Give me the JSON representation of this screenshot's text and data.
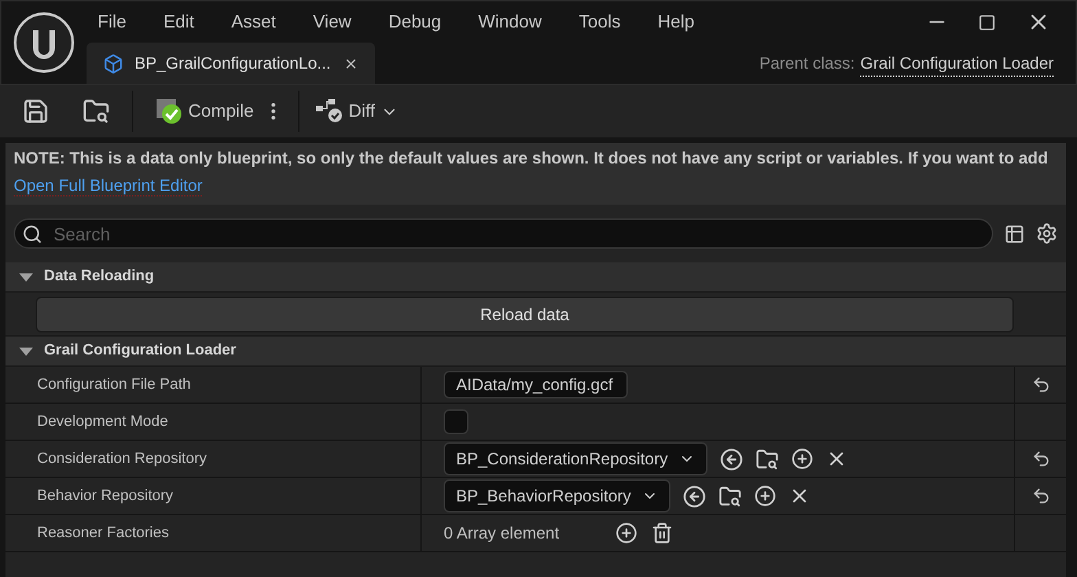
{
  "menu": [
    "File",
    "Edit",
    "Asset",
    "View",
    "Debug",
    "Window",
    "Tools",
    "Help"
  ],
  "tab": {
    "title": "BP_GrailConfigurationLo...",
    "selected": true
  },
  "parent_class": {
    "label": "Parent class:",
    "value": "Grail Configuration Loader"
  },
  "toolbar": {
    "compile": "Compile",
    "diff": "Diff"
  },
  "note": {
    "text": "NOTE: This is a data only blueprint, so only the default values are shown.  It does not have any script or variables.  If you want to add",
    "link": "Open Full Blueprint Editor"
  },
  "search": {
    "placeholder": "Search"
  },
  "sections": [
    {
      "title": "Data Reloading",
      "expanded": true,
      "button": "Reload data"
    },
    {
      "title": "Grail Configuration Loader",
      "expanded": true,
      "properties": [
        {
          "kind": "text",
          "name": "Configuration File Path",
          "value": "AIData/my_config.gcf",
          "resettable": true
        },
        {
          "kind": "checkbox",
          "name": "Development Mode",
          "checked": false,
          "resettable": false
        },
        {
          "kind": "asset",
          "name": "Consideration Repository",
          "value": "BP_ConsiderationRepository",
          "resettable": true
        },
        {
          "kind": "asset",
          "name": "Behavior Repository",
          "value": "BP_BehaviorRepository",
          "resettable": true
        },
        {
          "kind": "array",
          "name": "Reasoner Factories",
          "value": "0 Array element",
          "resettable": false
        }
      ]
    }
  ]
}
